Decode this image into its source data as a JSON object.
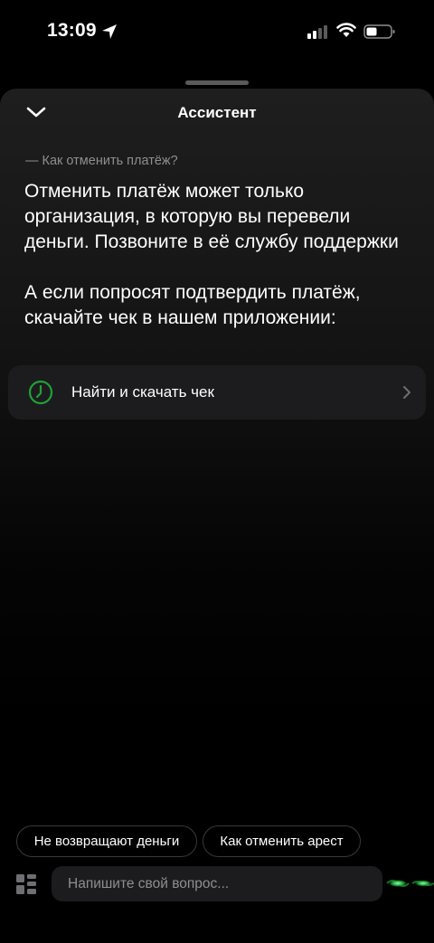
{
  "status_bar": {
    "time": "13:09"
  },
  "header": {
    "title": "Ассистент"
  },
  "chat": {
    "question": "— Как отменить платёж?",
    "answer_paragraphs": [
      "Отменить платёж может только организация, в которую вы перевели деньги. Позвоните в её службу поддержки",
      "А если попросят подтвердить платёж, скачайте чек в нашем приложении:"
    ],
    "action": {
      "label": "Найти и скачать чек"
    }
  },
  "suggestions": [
    "Не возвращают деньги",
    "Как отменить арест"
  ],
  "composer": {
    "placeholder": "Напишите свой вопрос..."
  },
  "colors": {
    "accent": "#21a038",
    "background": "#000000",
    "card": "#1c1c1e"
  }
}
